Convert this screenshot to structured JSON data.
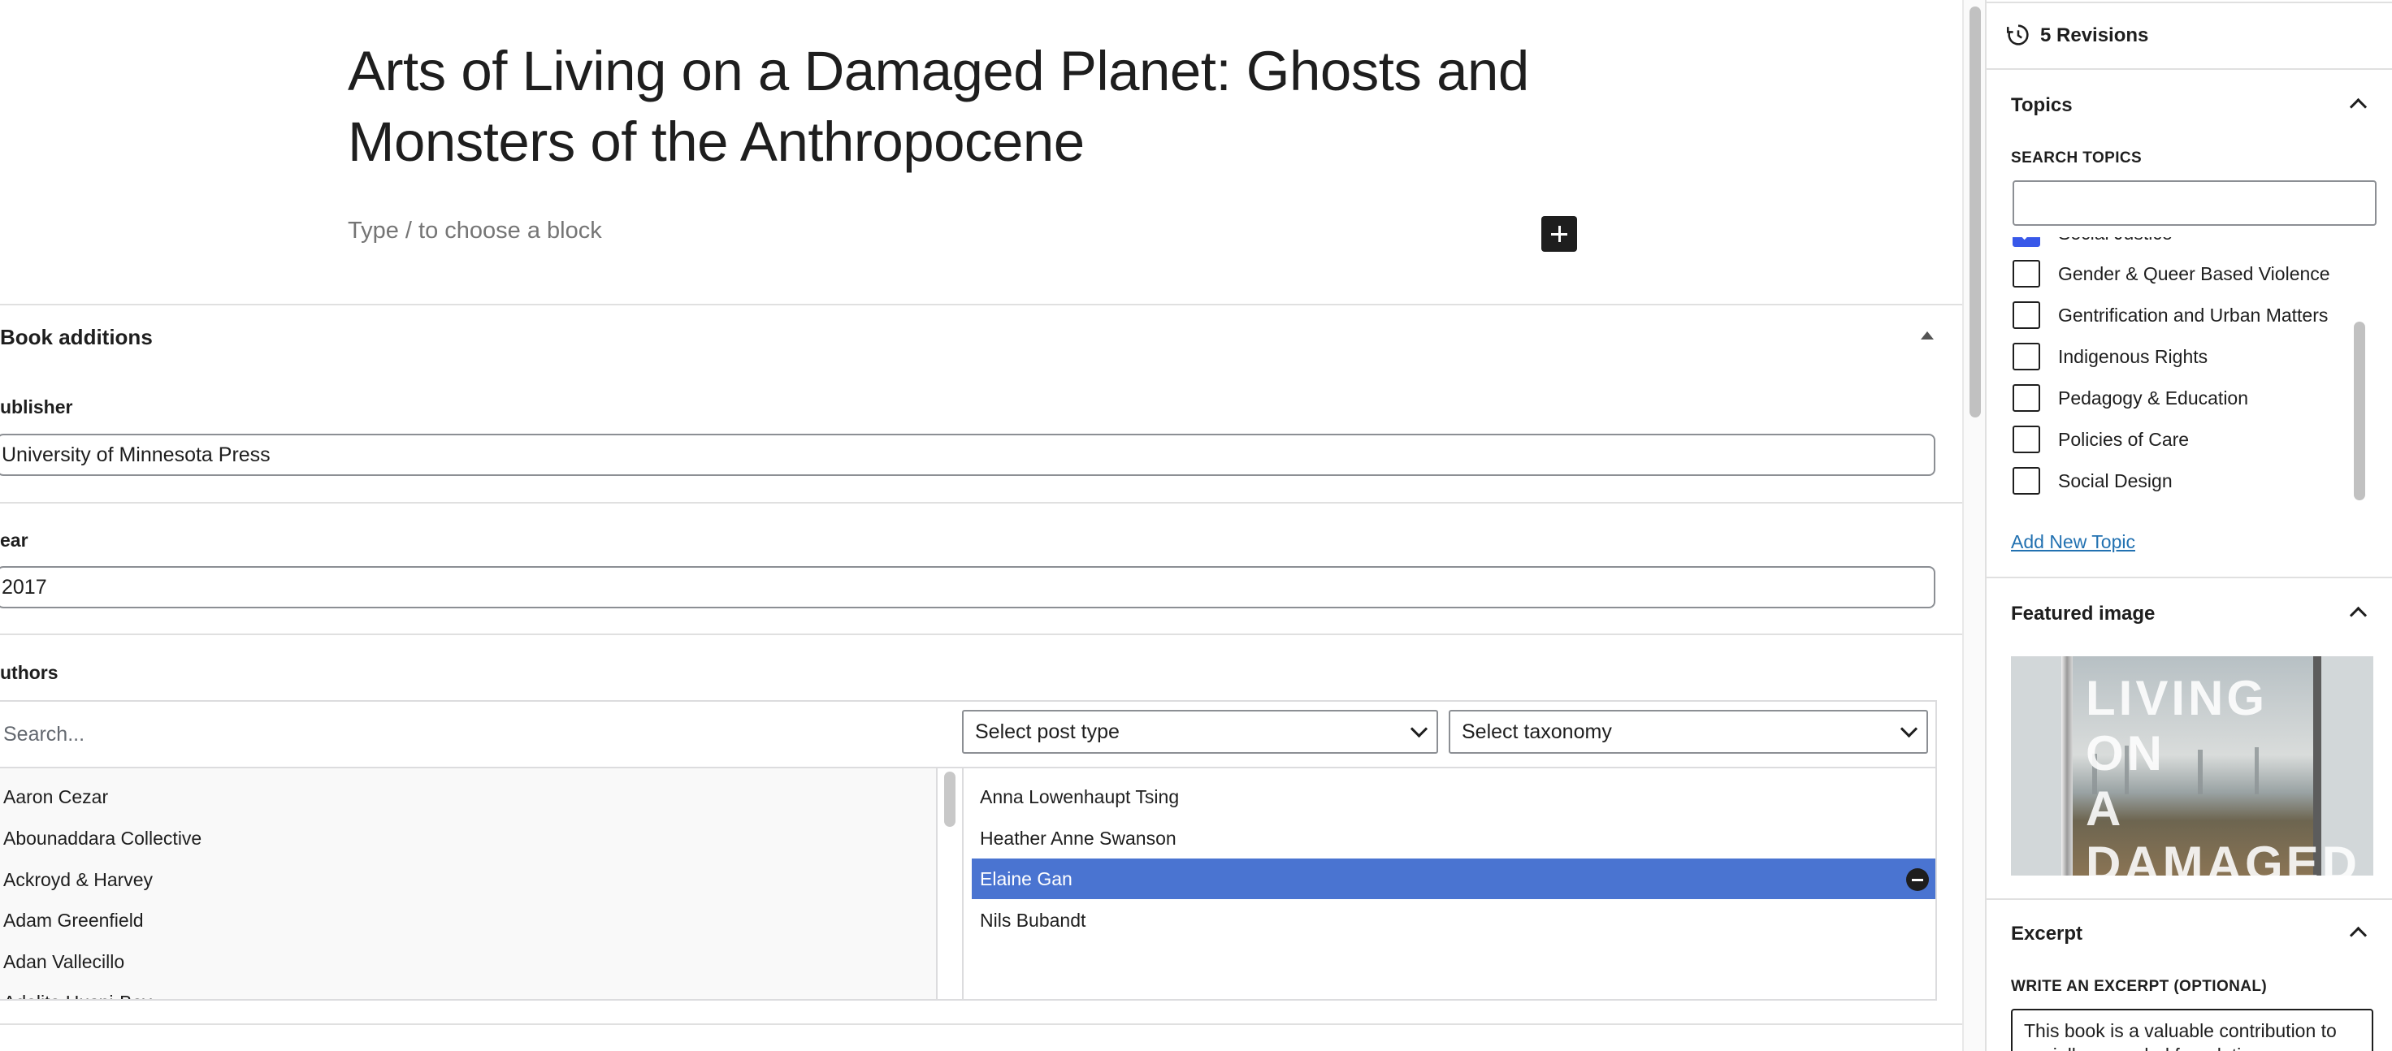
{
  "editor": {
    "post_title": "Arts of Living on a Damaged Planet: Ghosts and Monsters of the Anthropocene",
    "block_placeholder": "Type / to choose a block",
    "add_block_icon": "plus-icon"
  },
  "metabox": {
    "title": "Book additions",
    "publisher": {
      "label": "ublisher",
      "value": "University of Minnesota Press"
    },
    "year": {
      "label": "ear",
      "value": "2017"
    },
    "authors": {
      "label": "uthors",
      "search_placeholder": "Search...",
      "post_type_select": "Select post type",
      "taxonomy_select": "Select taxonomy",
      "choices": [
        "Aaron Cezar",
        "Abounaddara Collective",
        "Ackroyd & Harvey",
        "Adam Greenfield",
        "Adan Vallecillo",
        "Adelita Husni-Bey"
      ],
      "selected": [
        {
          "name": "Anna Lowenhaupt Tsing",
          "highlighted": false
        },
        {
          "name": "Heather Anne Swanson",
          "highlighted": false
        },
        {
          "name": "Elaine Gan",
          "highlighted": true
        },
        {
          "name": "Nils Bubandt",
          "highlighted": false
        }
      ],
      "highlight_color": "#4a74d1"
    }
  },
  "sidebar": {
    "revisions": "5 Revisions",
    "topics": {
      "title": "Topics",
      "search_label": "SEARCH TOPICS",
      "items": [
        {
          "label": "Social Justice",
          "checked": true
        },
        {
          "label": "Gender & Queer Based Violence",
          "checked": false
        },
        {
          "label": "Gentrification and Urban Matters",
          "checked": false
        },
        {
          "label": "Indigenous Rights",
          "checked": false
        },
        {
          "label": "Pedagogy & Education",
          "checked": false
        },
        {
          "label": "Policies of Care",
          "checked": false
        },
        {
          "label": "Social Design",
          "checked": false
        }
      ],
      "add_new": "Add New Topic"
    },
    "featured_image": {
      "title": "Featured image",
      "cover_text": [
        "LIVING",
        "ON",
        "A",
        "DAMAGED"
      ]
    },
    "excerpt": {
      "title": "Excerpt",
      "label": "WRITE AN EXCERPT (OPTIONAL)",
      "value": "This book is a valuable contribution to socially grounded foundations"
    }
  },
  "colors": {
    "accent": "#3858e9",
    "link": "#2271b1",
    "text": "#1e1e1e"
  }
}
